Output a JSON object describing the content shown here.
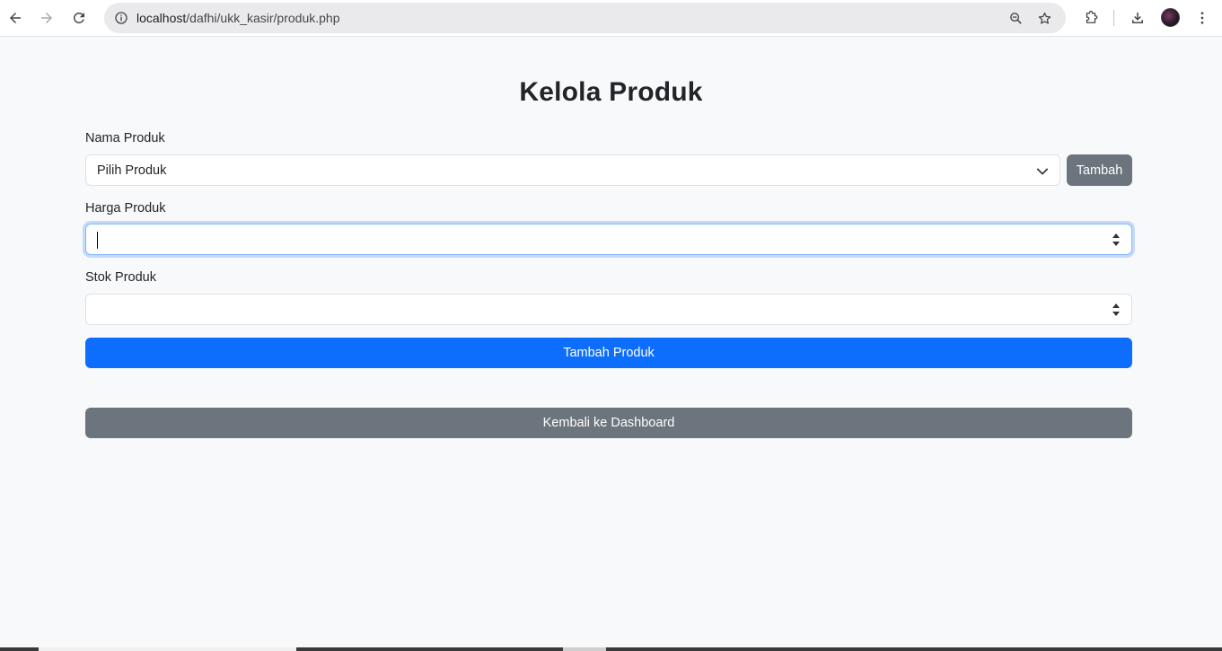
{
  "browser": {
    "url_host": "localhost",
    "url_path": "/dafhi/ukk_kasir/produk.php",
    "icons": [
      "back-arrow-icon",
      "forward-arrow-icon",
      "reload-icon",
      "site-info-icon",
      "zoom-icon",
      "star-icon",
      "extensions-icon",
      "download-icon",
      "profile-avatar",
      "kebab-menu-icon"
    ]
  },
  "page": {
    "title": "Kelola Produk"
  },
  "form": {
    "nama_label": "Nama Produk",
    "nama_select_value": "Pilih Produk",
    "tambah_button": "Tambah",
    "harga_label": "Harga Produk",
    "harga_value": "",
    "stok_label": "Stok Produk",
    "stok_value": "",
    "submit_button": "Tambah Produk"
  },
  "footer": {
    "back_button": "Kembali ke Dashboard"
  },
  "colors": {
    "primary": "#0d6efd",
    "secondary": "#6c757d",
    "background": "#f8f9fa",
    "focus_border": "#86b7fe"
  }
}
